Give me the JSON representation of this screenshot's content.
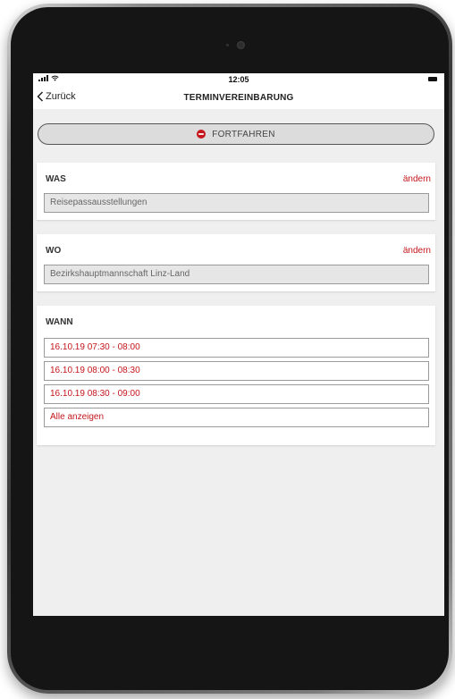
{
  "statusbar": {
    "time": "12:05",
    "signal_icon": "signal-icon",
    "wifi_icon": "wifi-icon",
    "battery_icon": "battery-icon"
  },
  "navbar": {
    "back_label": "Zurück",
    "title": "TERMINVEREINBARUNG"
  },
  "action": {
    "continue_label": "FORTFAHREN",
    "continue_icon": "stop-icon"
  },
  "was": {
    "title": "WAS",
    "edit_label": "ändern",
    "value": "Reisepassausstellungen"
  },
  "wo": {
    "title": "WO",
    "edit_label": "ändern",
    "value": "Bezirkshauptmannschaft Linz-Land"
  },
  "wann": {
    "title": "WANN",
    "slots": [
      "16.10.19 07:30 - 08:00",
      "16.10.19 08:00 - 08:30",
      "16.10.19 08:30 - 09:00"
    ],
    "show_all_label": "Alle anzeigen"
  },
  "colors": {
    "accent": "#c4161c",
    "background": "#efefef",
    "field_bg": "#e6e6e6"
  }
}
